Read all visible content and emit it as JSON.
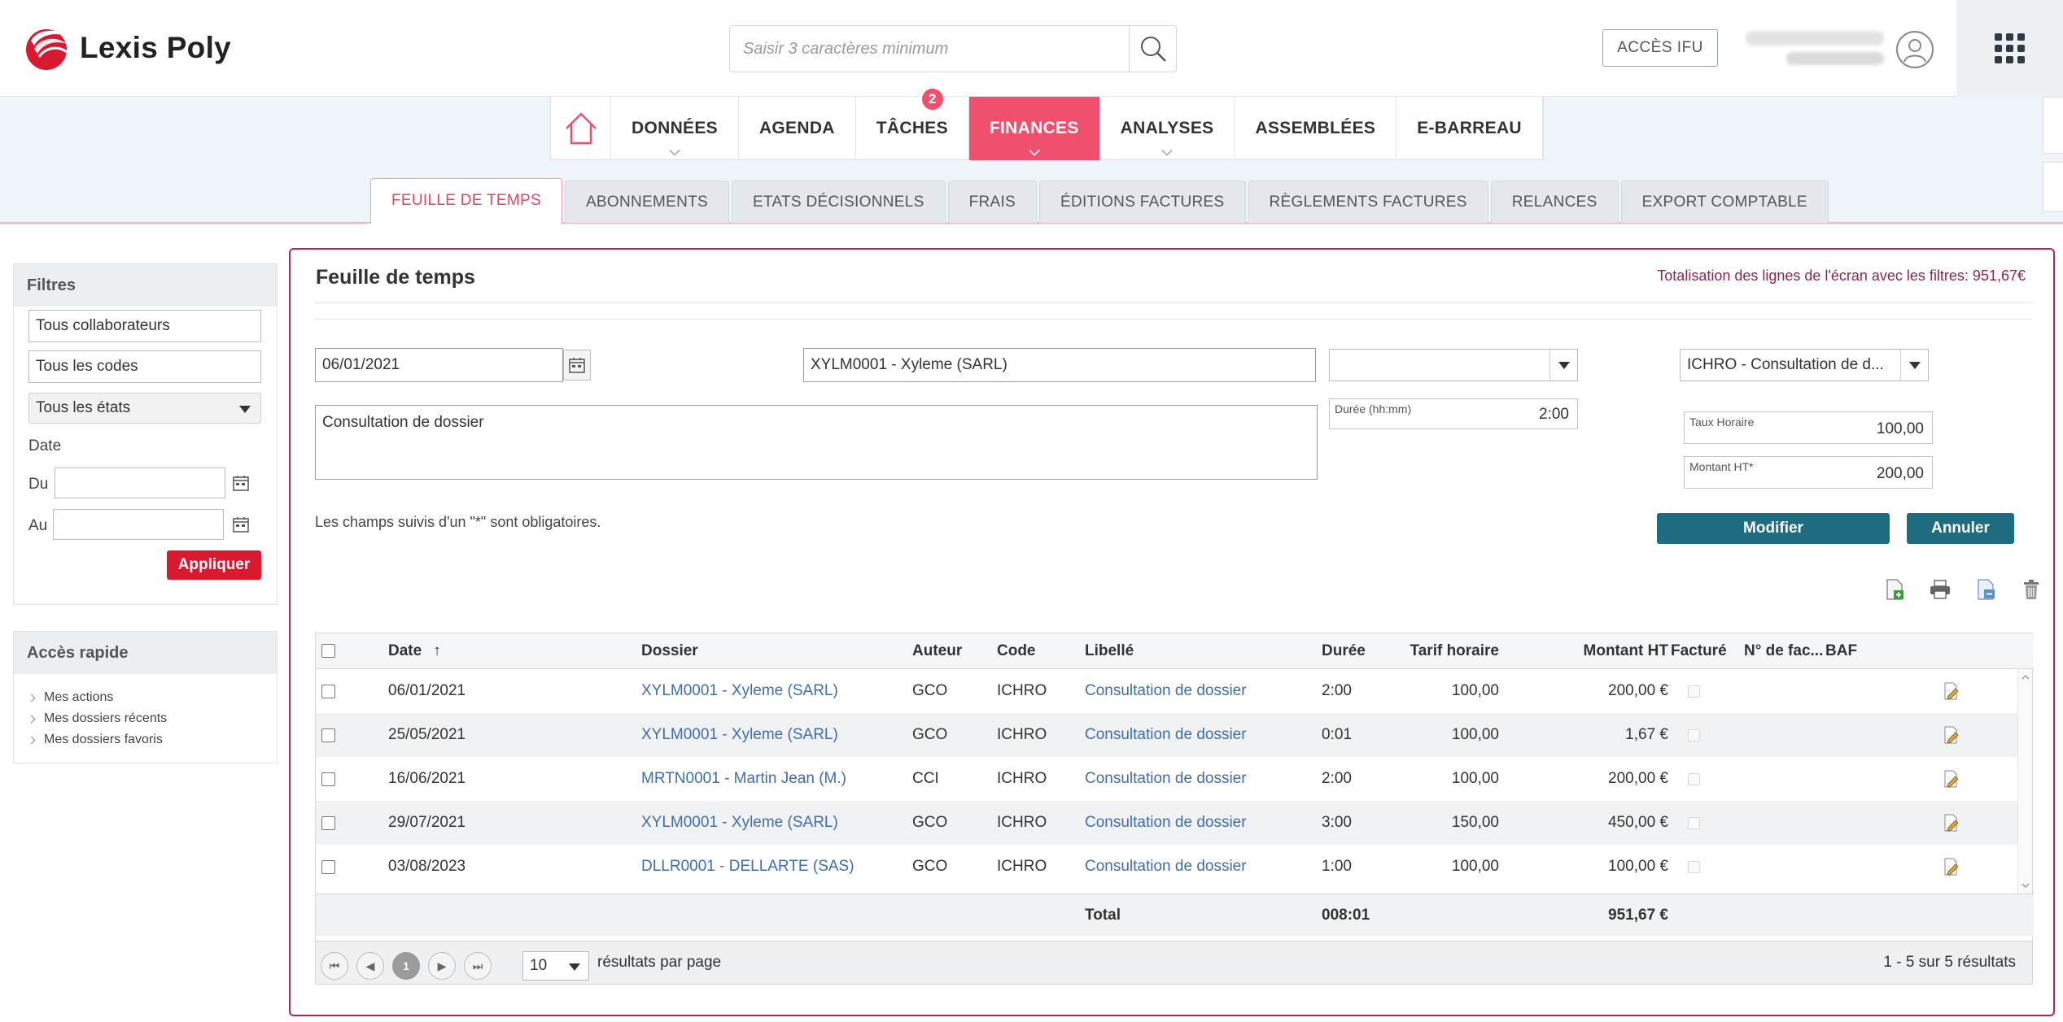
{
  "brand": {
    "name": "Lexis Poly",
    "accent": "#f0506e",
    "logo_color": "#d8192f"
  },
  "header": {
    "search_placeholder": "Saisir 3 caractères minimum",
    "ifu_label": "ACCÈS IFU"
  },
  "main_nav": {
    "items": [
      {
        "label": "DONNÉES"
      },
      {
        "label": "AGENDA"
      },
      {
        "label": "TÂCHES",
        "badge": "2"
      },
      {
        "label": "FINANCES",
        "active": true
      },
      {
        "label": "ANALYSES"
      },
      {
        "label": "ASSEMBLÉES"
      },
      {
        "label": "E-BARREAU"
      }
    ]
  },
  "sub_nav": {
    "tabs": [
      {
        "label": "FEUILLE DE TEMPS",
        "active": true
      },
      {
        "label": "ABONNEMENTS"
      },
      {
        "label": "ETATS DÉCISIONNELS"
      },
      {
        "label": "FRAIS"
      },
      {
        "label": "ÉDITIONS FACTURES"
      },
      {
        "label": "RÈGLEMENTS FACTURES"
      },
      {
        "label": "RELANCES"
      },
      {
        "label": "EXPORT COMPTABLE"
      }
    ]
  },
  "filters": {
    "title": "Filtres",
    "collaborators": "Tous collaborateurs",
    "codes": "Tous les codes",
    "states": "Tous les états",
    "date_label": "Date",
    "from_label": "Du",
    "to_label": "Au",
    "apply_label": "Appliquer"
  },
  "quick_access": {
    "title": "Accès rapide",
    "items": [
      "Mes actions",
      "Mes dossiers récents",
      "Mes dossiers favoris"
    ]
  },
  "page": {
    "title": "Feuille de temps",
    "total_text": "Totalisation des lignes de l'écran avec les filtres: 951,67€"
  },
  "form": {
    "date": "06/01/2021",
    "dossier": "XYLM0001 - Xyleme (SARL)",
    "blank_select": "",
    "code_select": "ICHRO - Consultation de d...",
    "description": "Consultation de dossier",
    "duration_label": "Durée (hh:mm)",
    "duration": "2:00",
    "rate_label": "Taux Horaire",
    "rate": "100,00",
    "amount_label": "Montant HT*",
    "amount": "200,00",
    "required_note": "Les champs suivis d'un \"*\" sont obligatoires.",
    "modify_label": "Modifier",
    "cancel_label": "Annuler"
  },
  "table": {
    "columns": {
      "date": "Date",
      "dossier": "Dossier",
      "auteur": "Auteur",
      "code": "Code",
      "libelle": "Libellé",
      "duree": "Durée",
      "tarif": "Tarif horaire",
      "montant": "Montant HT",
      "facture": "Facturé",
      "num_facture": "N° de fac...",
      "baf": "BAF"
    },
    "sort_indicator": "↑",
    "rows": [
      {
        "date": "06/01/2021",
        "dossier": "XYLM0001 - Xyleme (SARL)",
        "auteur": "GCO",
        "code": "ICHRO",
        "libelle": "Consultation de dossier",
        "duree": "2:00",
        "tarif": "100,00",
        "montant": "200,00 €"
      },
      {
        "date": "25/05/2021",
        "dossier": "XYLM0001 - Xyleme (SARL)",
        "auteur": "GCO",
        "code": "ICHRO",
        "libelle": "Consultation de dossier",
        "duree": "0:01",
        "tarif": "100,00",
        "montant": "1,67 €"
      },
      {
        "date": "16/06/2021",
        "dossier": "MRTN0001 - Martin Jean (M.)",
        "auteur": "CCI",
        "code": "ICHRO",
        "libelle": "Consultation de dossier",
        "duree": "2:00",
        "tarif": "100,00",
        "montant": "200,00 €"
      },
      {
        "date": "29/07/2021",
        "dossier": "XYLM0001 - Xyleme (SARL)",
        "auteur": "GCO",
        "code": "ICHRO",
        "libelle": "Consultation de dossier",
        "duree": "3:00",
        "tarif": "150,00",
        "montant": "450,00 €"
      },
      {
        "date": "03/08/2023",
        "dossier": "DLLR0001 - DELLARTE (SAS)",
        "auteur": "GCO",
        "code": "ICHRO",
        "libelle": "Consultation de dossier",
        "duree": "1:00",
        "tarif": "100,00",
        "montant": "100,00 €"
      }
    ],
    "total_label": "Total",
    "total_duree": "008:01",
    "total_montant": "951,67 €"
  },
  "pagination": {
    "current_page": "1",
    "page_size": "10",
    "per_page_label": "résultats par page",
    "summary": "1 - 5 sur 5 résultats"
  }
}
